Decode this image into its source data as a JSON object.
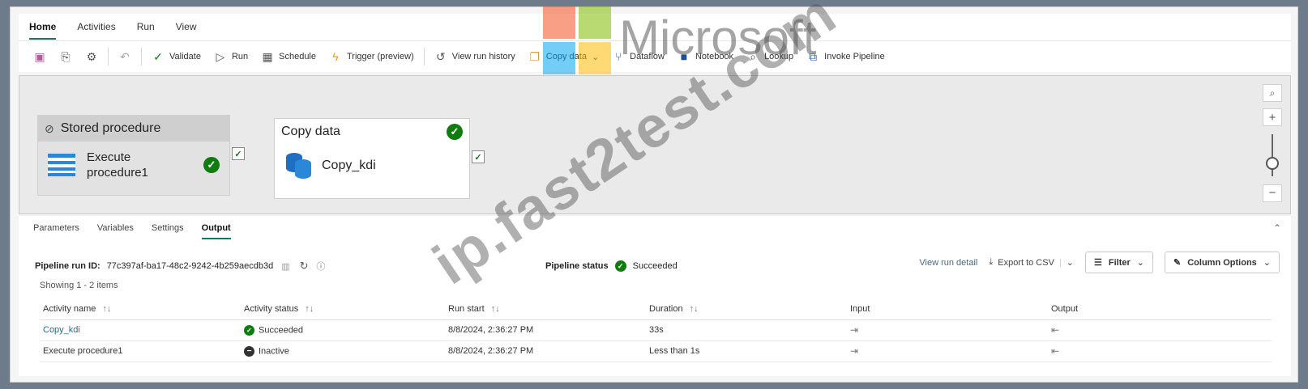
{
  "menu": {
    "tabs": [
      {
        "label": "Home",
        "active": true
      },
      {
        "label": "Activities",
        "active": false
      },
      {
        "label": "Run",
        "active": false
      },
      {
        "label": "View",
        "active": false
      }
    ]
  },
  "toolbar": {
    "validate": "Validate",
    "run": "Run",
    "schedule": "Schedule",
    "trigger": "Trigger (preview)",
    "view_run_history": "View run history",
    "copy_data": "Copy data",
    "dataflow": "Dataflow",
    "notebook": "Notebook",
    "lookup": "Lookup",
    "invoke_pipeline": "Invoke Pipeline"
  },
  "canvas": {
    "node1": {
      "type_label": "Stored procedure",
      "name": "Execute procedure1"
    },
    "node2": {
      "type_label": "Copy data",
      "name": "Copy_kdi"
    }
  },
  "panel": {
    "tabs": [
      "Parameters",
      "Variables",
      "Settings",
      "Output"
    ],
    "active_tab": "Output",
    "run_id_label": "Pipeline run ID:",
    "run_id": "77c397af-ba17-48c2-9242-4b259aecdb3d",
    "status_label": "Pipeline status",
    "status_value": "Succeeded",
    "view_run_detail": "View run detail",
    "export_csv": "Export to CSV",
    "filter": "Filter",
    "column_options": "Column Options",
    "showing": "Showing 1 - 2 items",
    "columns": [
      "Activity name",
      "Activity status",
      "Run start",
      "Duration",
      "Input",
      "Output"
    ],
    "rows": [
      {
        "name": "Copy_kdi",
        "status": "Succeeded",
        "status_kind": "ok",
        "run_start": "8/8/2024, 2:36:27 PM",
        "duration": "33s"
      },
      {
        "name": "Execute procedure1",
        "status": "Inactive",
        "status_kind": "inactive",
        "run_start": "8/8/2024, 2:36:27 PM",
        "duration": "Less than 1s"
      }
    ]
  },
  "watermark": {
    "brand": "Microsoft",
    "site": "ip.fast2test.com"
  },
  "colors": {
    "accent": "#117865",
    "success": "#107c10"
  }
}
